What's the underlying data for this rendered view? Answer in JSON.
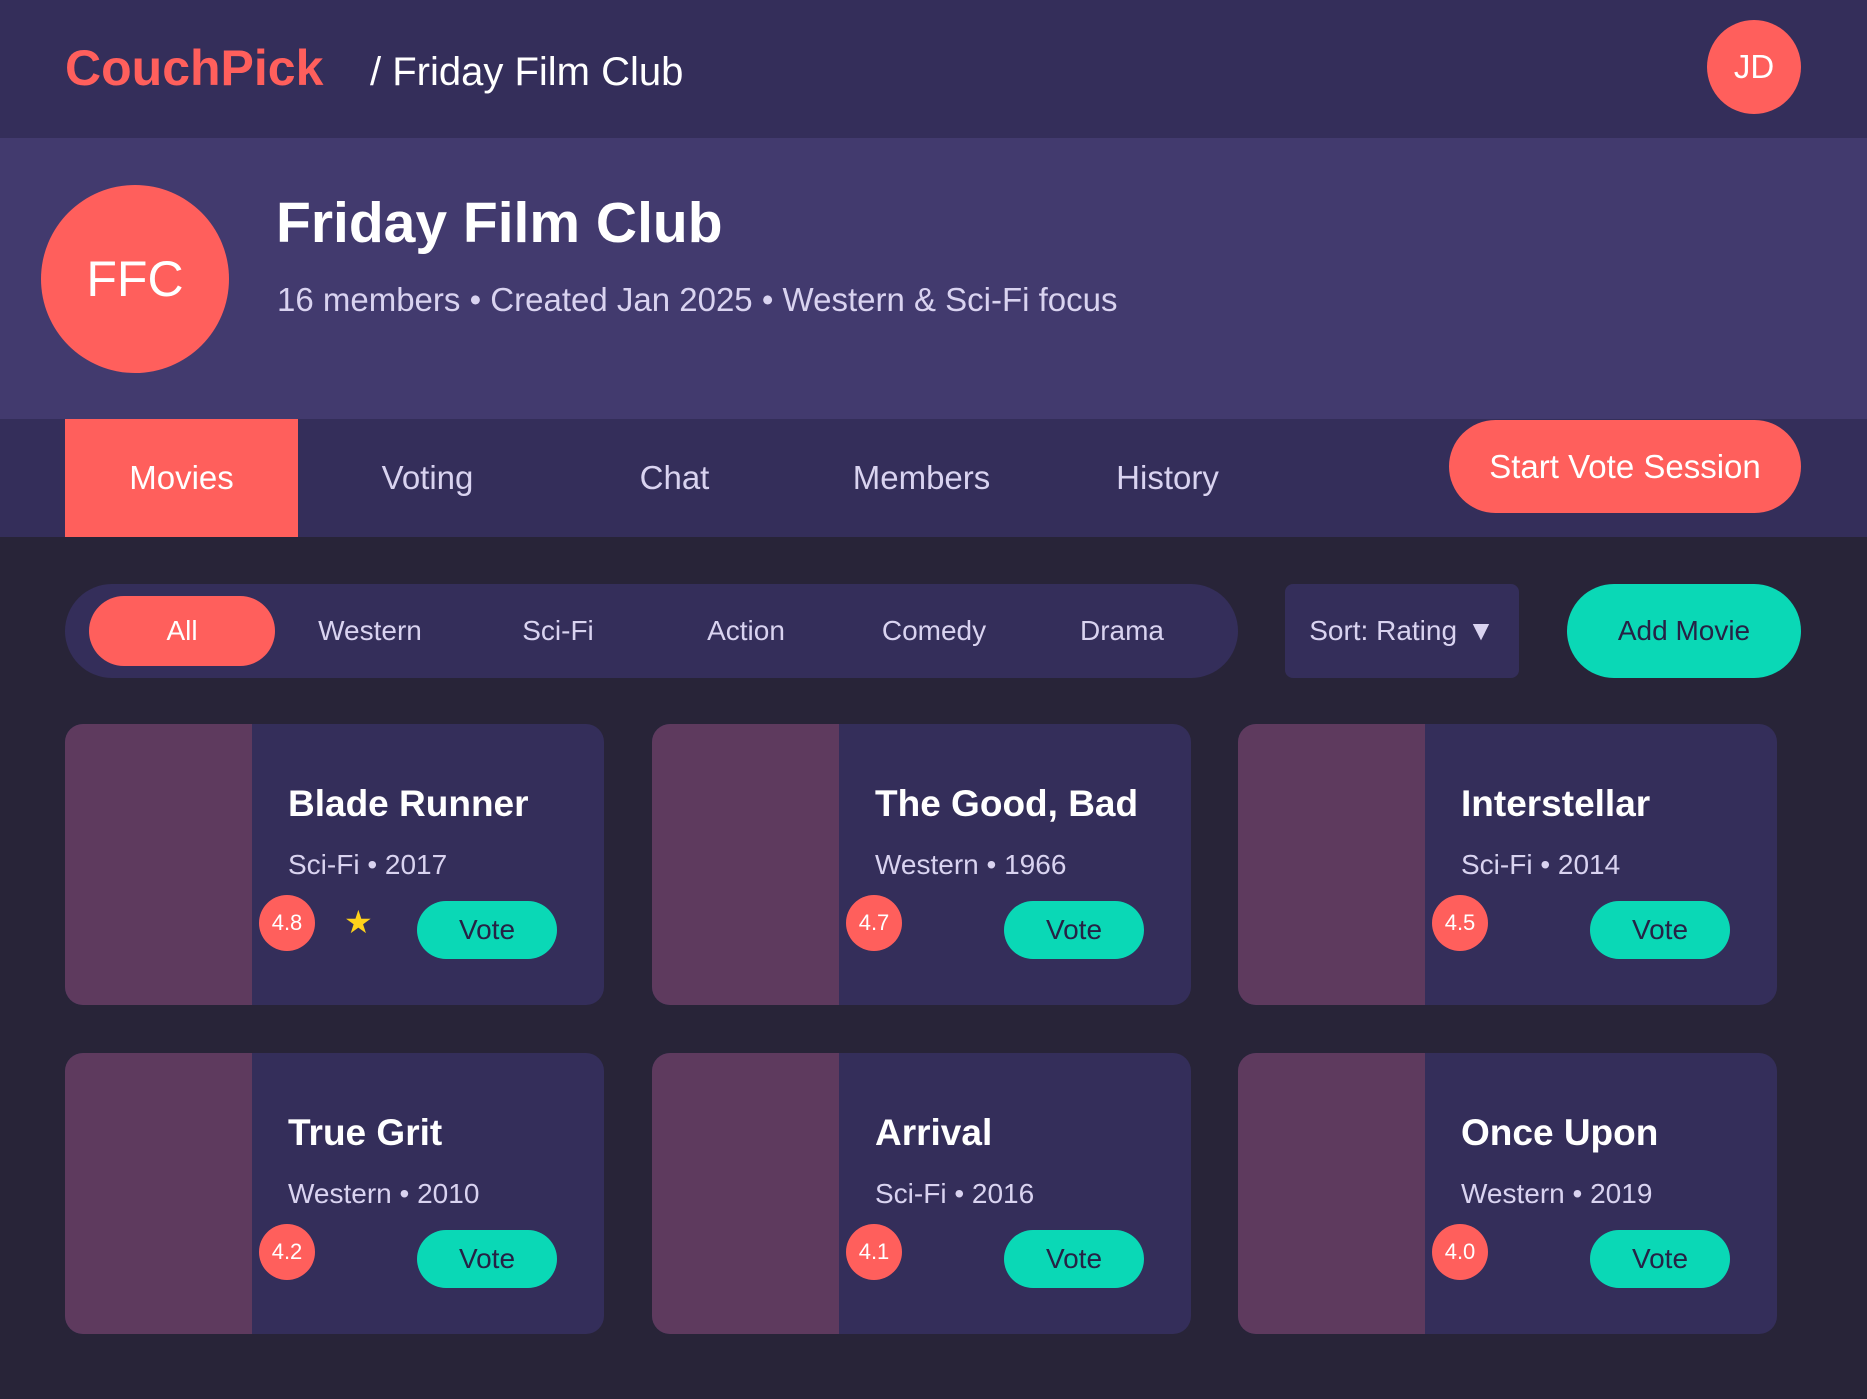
{
  "header": {
    "brand": "CouchPick",
    "breadcrumb": "/ Friday Film Club",
    "user_initials": "JD"
  },
  "club": {
    "logo_text": "FFC",
    "name": "Friday Film Club",
    "meta": "16 members • Created Jan 2025 • Western & Sci-Fi focus"
  },
  "tabs": [
    {
      "label": "Movies",
      "active": true
    },
    {
      "label": "Voting",
      "active": false
    },
    {
      "label": "Chat",
      "active": false
    },
    {
      "label": "Members",
      "active": false
    },
    {
      "label": "History",
      "active": false
    }
  ],
  "start_vote_label": "Start Vote Session",
  "filters": {
    "chips": [
      {
        "label": "All",
        "active": true
      },
      {
        "label": "Western",
        "active": false
      },
      {
        "label": "Sci-Fi",
        "active": false
      },
      {
        "label": "Action",
        "active": false
      },
      {
        "label": "Comedy",
        "active": false
      },
      {
        "label": "Drama",
        "active": false
      }
    ],
    "sort_label": "Sort: Rating",
    "sort_caret": "▼",
    "add_movie_label": "Add Movie"
  },
  "movies": [
    {
      "title": "Blade Runner",
      "meta": "Sci-Fi • 2017",
      "rating": "4.8",
      "favorite": true,
      "favorite_icon": "★",
      "vote_label": "Vote"
    },
    {
      "title": "The Good, Bad",
      "meta": "Western • 1966",
      "rating": "4.7",
      "favorite": false,
      "vote_label": "Vote"
    },
    {
      "title": "Interstellar",
      "meta": "Sci-Fi • 2014",
      "rating": "4.5",
      "favorite": false,
      "vote_label": "Vote"
    },
    {
      "title": "True Grit",
      "meta": "Western • 2010",
      "rating": "4.2",
      "favorite": false,
      "vote_label": "Vote"
    },
    {
      "title": "Arrival",
      "meta": "Sci-Fi • 2016",
      "rating": "4.1",
      "favorite": false,
      "vote_label": "Vote"
    },
    {
      "title": "Once Upon",
      "meta": "Western • 2019",
      "rating": "4.0",
      "favorite": false,
      "vote_label": "Vote"
    }
  ],
  "colors": {
    "accent": "#ff5f5c",
    "teal": "#0ad8b6",
    "panel": "#342e5a",
    "header_band": "#423a6e",
    "background": "#282438",
    "poster": "#5e3a5e",
    "star": "#ffd21a"
  }
}
